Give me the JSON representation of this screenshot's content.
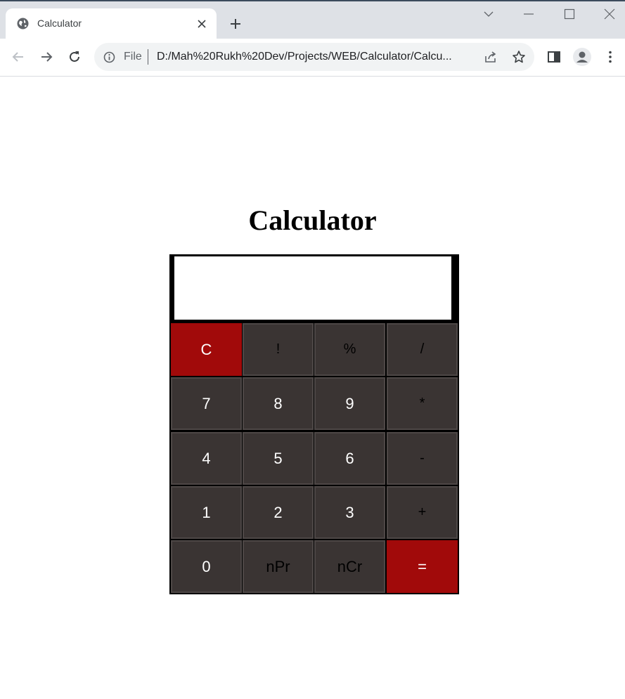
{
  "browser": {
    "tab_title": "Calculator",
    "scheme_label": "File",
    "url": "D:/Mah%20Rukh%20Dev/Projects/WEB/Calculator/Calcu..."
  },
  "page": {
    "title": "Calculator",
    "display_value": ""
  },
  "keys": {
    "clear": "C",
    "factorial": "!",
    "percent": "%",
    "divide": "/",
    "seven": "7",
    "eight": "8",
    "nine": "9",
    "multiply": "*",
    "four": "4",
    "five": "5",
    "six": "6",
    "subtract": "-",
    "one": "1",
    "two": "2",
    "three": "3",
    "add": "+",
    "zero": "0",
    "npr": "nPr",
    "ncr": "nCr",
    "equals": "="
  },
  "colors": {
    "key_bg": "#3a3433",
    "accent_red": "#a10a0a",
    "calc_frame": "#000000"
  }
}
